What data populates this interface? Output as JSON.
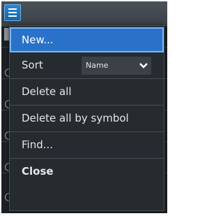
{
  "toolbar": {
    "menu_icon": "hamburger-menu-icon"
  },
  "menu": {
    "items": [
      {
        "label": "New...",
        "selected": true
      },
      {
        "label": "Sort"
      },
      {
        "label": "Delete all"
      },
      {
        "label": "Delete all by symbol"
      },
      {
        "label": "Find..."
      },
      {
        "label": "Close",
        "bold": true
      }
    ],
    "sort": {
      "value": "Name",
      "icon": "chevron-down-icon"
    }
  },
  "colors": {
    "selected": "#2a72c9",
    "selected_border": "#7cb8f3",
    "menu_bg": "#262b30",
    "topbar": "#3f454b"
  }
}
